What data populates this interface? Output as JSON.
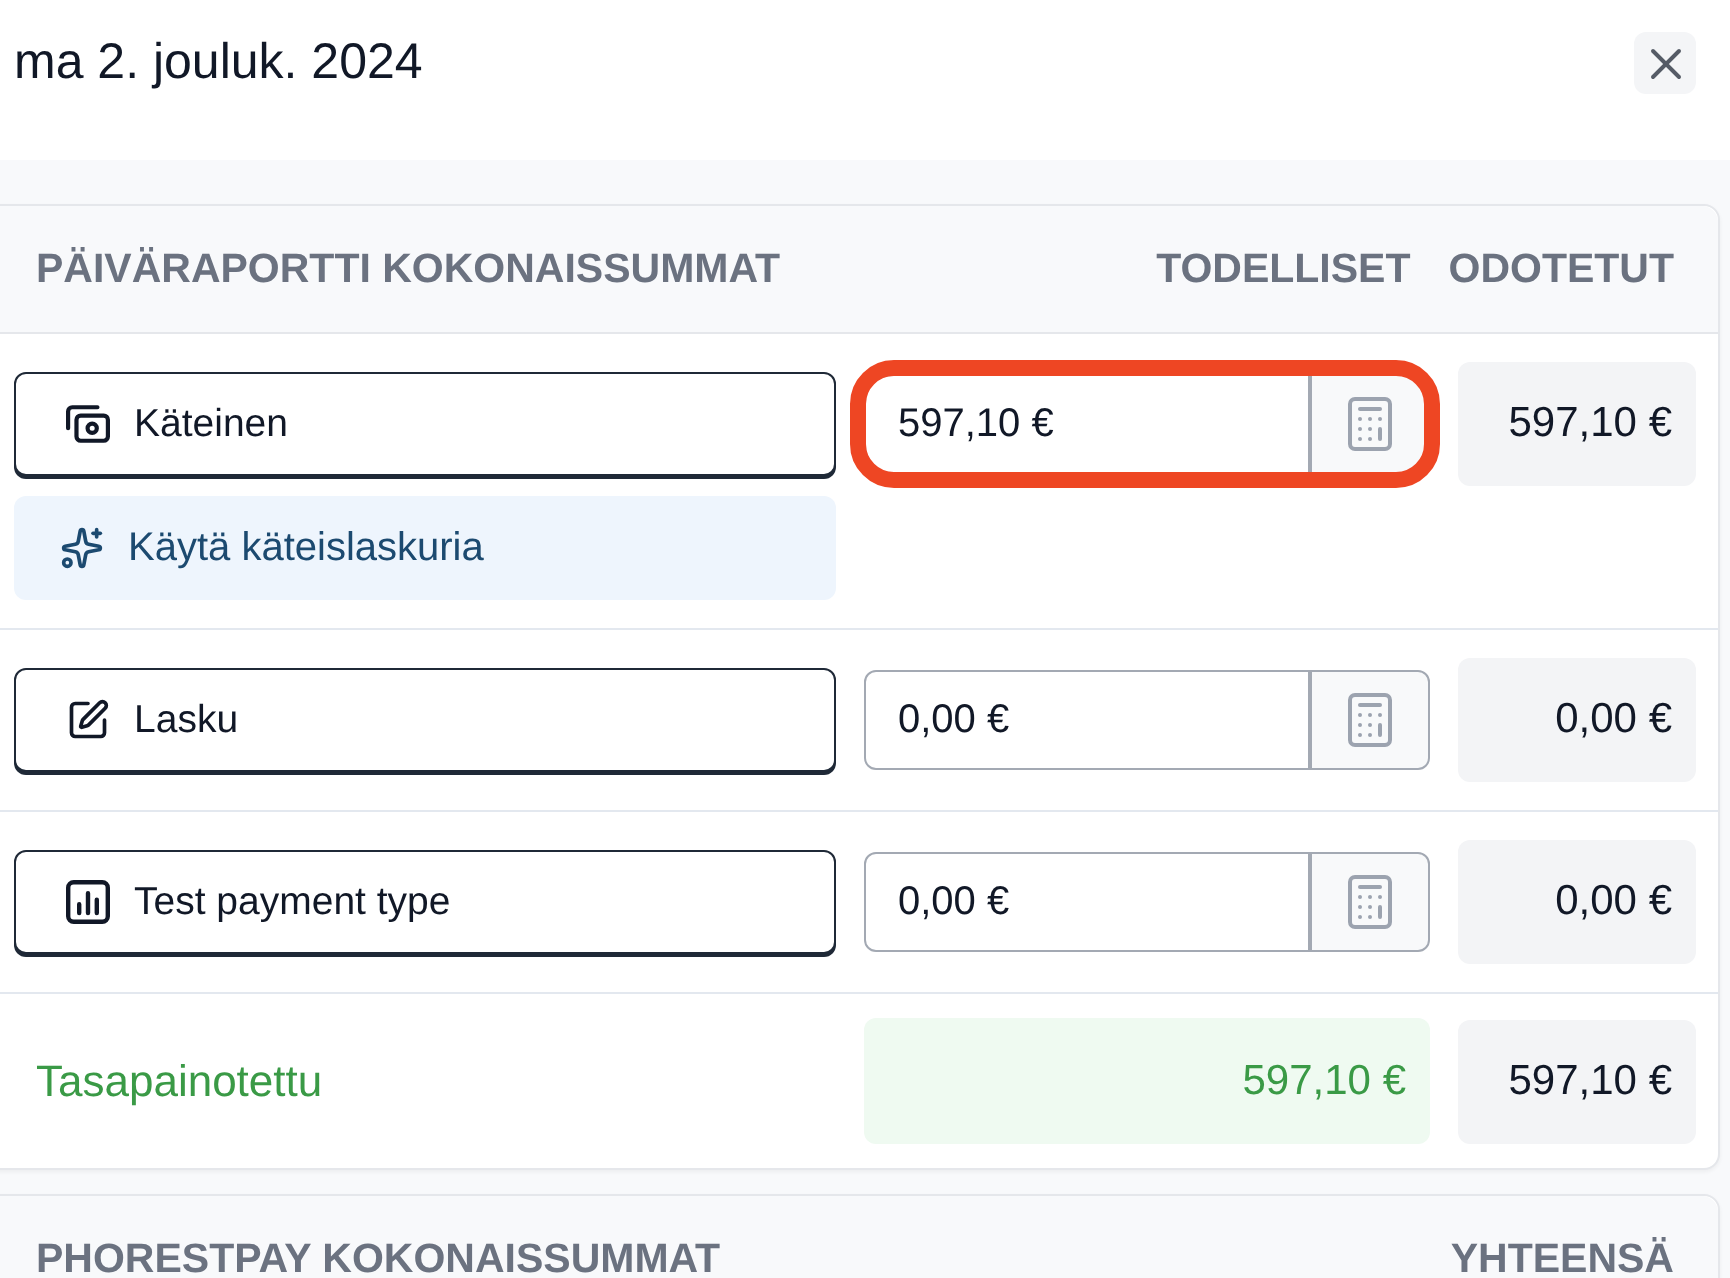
{
  "dialog": {
    "title": "ma 2. jouluk. 2024"
  },
  "daily_totals": {
    "heading": "PÄIVÄRAPORTTI KOKONAISSUMMAT",
    "columns": [
      "TODELLISET",
      "ODOTETUT"
    ],
    "payment_types": [
      {
        "kind": "cash",
        "label": "Käteinen",
        "actual": "597,10 €",
        "expected": "597,10 €",
        "highlighted": true,
        "helper_action": "Käytä käteislaskuria"
      },
      {
        "kind": "invoice",
        "label": "Lasku",
        "actual": "0,00 €",
        "expected": "0,00 €",
        "highlighted": false
      },
      {
        "kind": "report",
        "label": "Test payment type",
        "actual": "0,00 €",
        "expected": "0,00 €",
        "highlighted": false
      }
    ],
    "total": {
      "label": "Tasapainotettu",
      "balanced": true,
      "actual": "597,10 €",
      "expected": "597,10 €"
    }
  },
  "phorestpay_totals": {
    "heading": "PHORESTPAY KOKONAISSUMMAT",
    "columns": [
      "YHTEENSÄ"
    ]
  }
}
